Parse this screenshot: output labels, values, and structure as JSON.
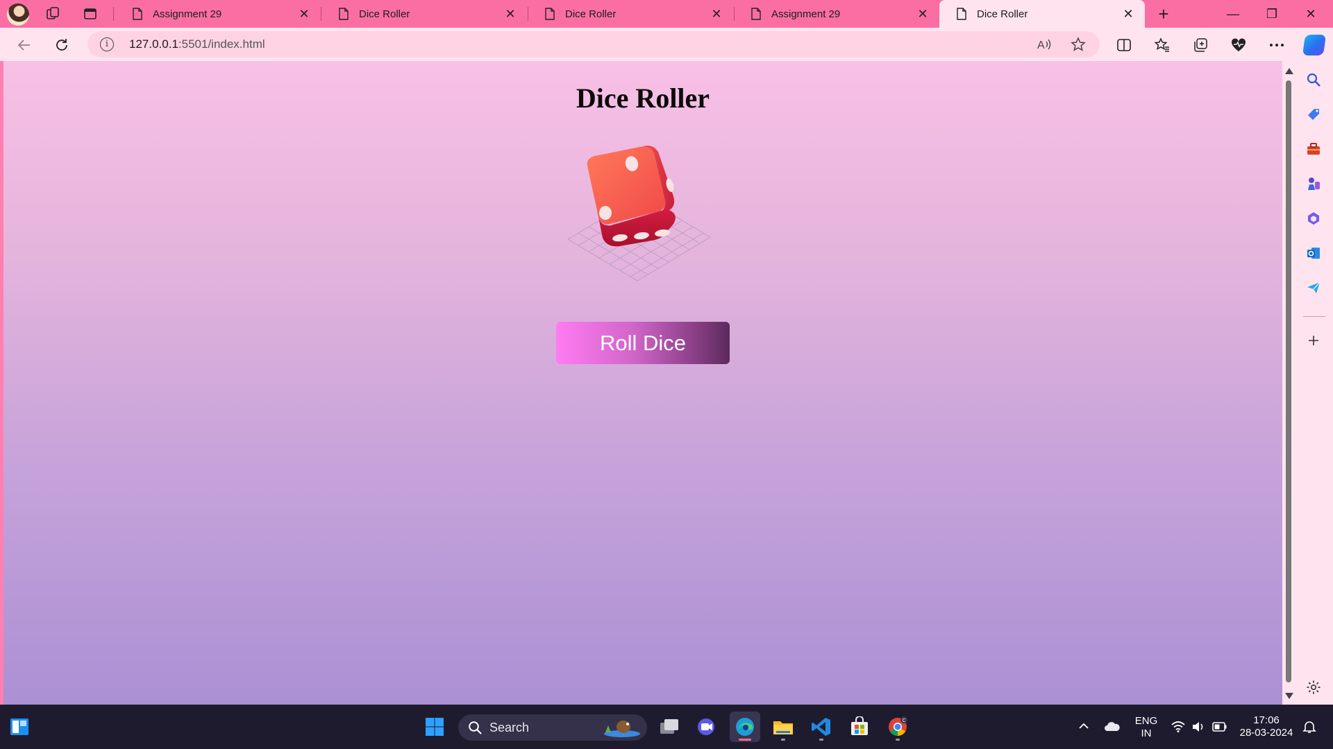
{
  "browser": {
    "tabs": [
      {
        "title": "Assignment 29",
        "active": false
      },
      {
        "title": "Dice Roller",
        "active": false
      },
      {
        "title": "Dice Roller",
        "active": false
      },
      {
        "title": "Assignment 29",
        "active": false
      },
      {
        "title": "Dice Roller",
        "active": true
      }
    ],
    "tab_close_glyph": "✕",
    "new_tab_glyph": "+",
    "window_controls": {
      "minimize": "—",
      "restore": "❐",
      "close": "✕"
    },
    "address": {
      "host": "127.0.0.1",
      "rest": ":5501/index.html"
    },
    "info_glyph": "i"
  },
  "page": {
    "title": "Dice Roller",
    "button_label": "Roll Dice",
    "dice_face": "three pips top-face, two visible side faces",
    "colors": {
      "gradient_top": "#f9c0e6",
      "gradient_bottom": "#ab90d4",
      "dice": "#f0504e",
      "button_start": "#ff7cf2",
      "button_end": "#5b2a5e"
    }
  },
  "sidebar": {
    "icons": [
      "search-icon",
      "shopping-tag-icon",
      "toolbox-icon",
      "games-icon",
      "copilot-apps-icon",
      "outlook-icon",
      "send-icon",
      "add-icon",
      "settings-icon"
    ]
  },
  "taskbar": {
    "search_label": "Search",
    "language": {
      "line1": "ENG",
      "line2": "IN"
    },
    "clock": {
      "time": "17:06",
      "date": "28-03-2024"
    },
    "apps": [
      "start-icon",
      "task-view-icon",
      "meet-icon",
      "edge-icon",
      "file-explorer-icon",
      "vscode-icon",
      "store-icon",
      "chrome-icon"
    ]
  }
}
